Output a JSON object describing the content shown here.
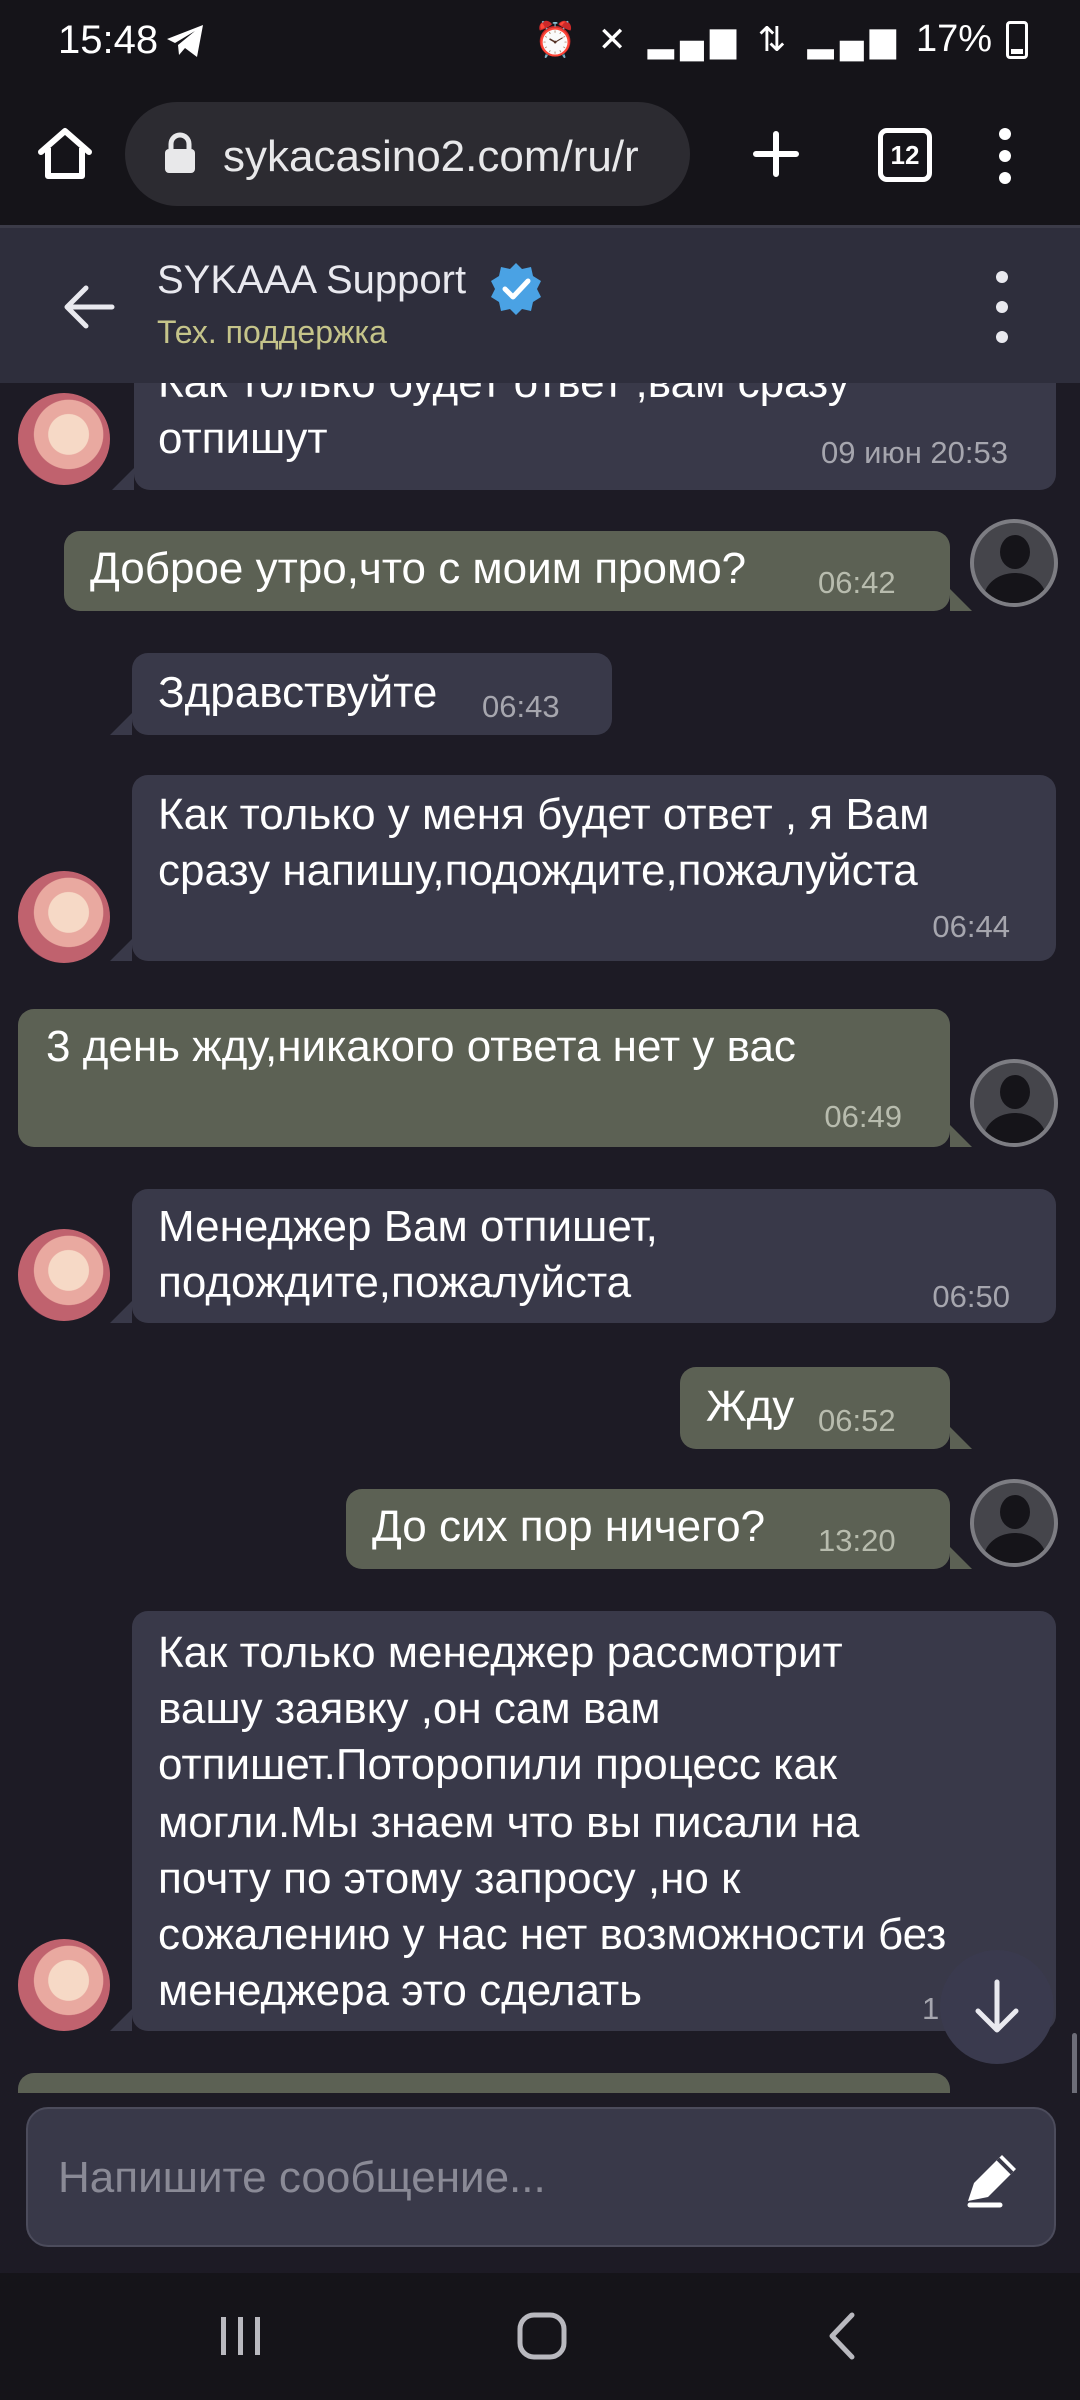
{
  "status_bar": {
    "time": "15:48",
    "battery": "17%"
  },
  "browser": {
    "url": "sykacasino2.com/ru/r",
    "tab_count": "12"
  },
  "chat_header": {
    "title": "SYKAAA Support",
    "subtitle": "Тех. поддержка"
  },
  "messages": [
    {
      "from": "agent",
      "text_line1": "Как только будет ответ ,вам сразу",
      "text_line2": "отпишут",
      "time": "09 июн 20:53"
    },
    {
      "from": "user",
      "text": "Доброе утро,что с моим промо?",
      "time": "06:42"
    },
    {
      "from": "agent",
      "text": "Здравствуйте",
      "time": "06:43"
    },
    {
      "from": "agent",
      "text_line1": "Как только  у меня будет ответ , я Вам",
      "text_line2": "сразу напишу,подождите,пожалуйста",
      "time": "06:44"
    },
    {
      "from": "user",
      "text": "3 день жду,никакого ответа нет у вас",
      "time": "06:49"
    },
    {
      "from": "agent",
      "text_line1": "Менеджер Вам отпишет,",
      "text_line2": "подождите,пожалуйста",
      "time": "06:50"
    },
    {
      "from": "user",
      "text": "Жду",
      "time": "06:52"
    },
    {
      "from": "user",
      "text": "До сих пор ничего?",
      "time": "13:20"
    },
    {
      "from": "agent",
      "lines": [
        "Как только менеджер рассмотрит",
        "вашу заявку ,он сам вам",
        "отпишет.Поторопили процесс как",
        "могли.Мы знаем что вы писали на",
        "почту по этому запросу ,но к",
        "сожалению у нас нет возможности без",
        "менеджера это сделать"
      ],
      "time": "1"
    }
  ],
  "input": {
    "placeholder": "Напишите сообщение..."
  }
}
